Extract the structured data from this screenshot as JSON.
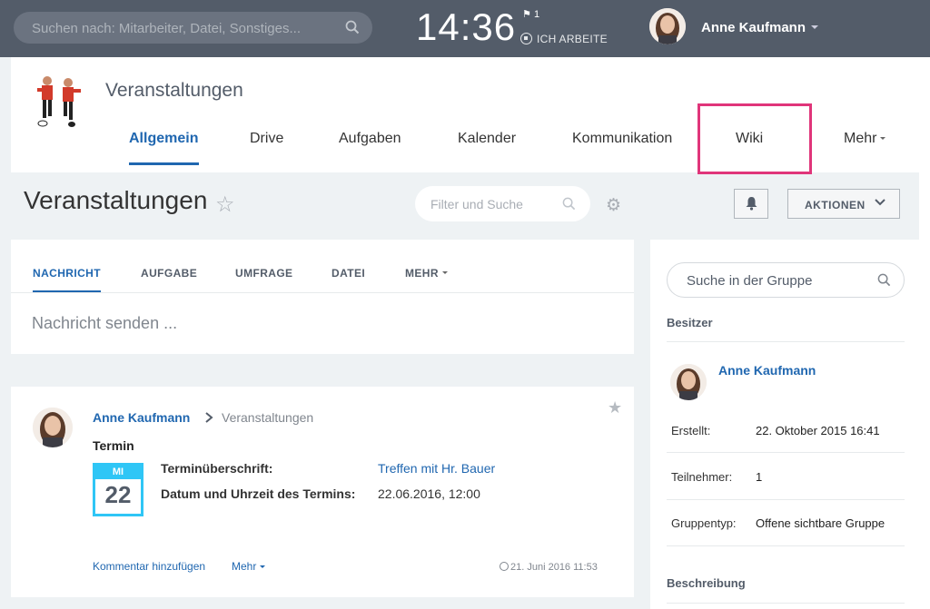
{
  "topbar": {
    "search_placeholder": "Suchen nach: Mitarbeiter, Datei, Sonstiges...",
    "clock": "14:36",
    "flag_count": "1",
    "work_status": "ICH ARBEITE",
    "user_name": "Anne Kaufmann"
  },
  "group": {
    "title": "Veranstaltungen",
    "tabs": [
      {
        "label": "Allgemein"
      },
      {
        "label": "Drive"
      },
      {
        "label": "Aufgaben"
      },
      {
        "label": "Kalender"
      },
      {
        "label": "Kommunikation"
      },
      {
        "label": "Wiki"
      },
      {
        "label": "Mehr"
      }
    ],
    "highlight_color": "#e0357a"
  },
  "page": {
    "title": "Veranstaltungen",
    "filter_placeholder": "Filter und Suche",
    "actions_label": "AKTIONEN"
  },
  "composer": {
    "tabs": [
      {
        "label": "NACHRICHT"
      },
      {
        "label": "AUFGABE"
      },
      {
        "label": "UMFRAGE"
      },
      {
        "label": "DATEI"
      },
      {
        "label": "MEHR"
      }
    ],
    "placeholder": "Nachricht senden ..."
  },
  "post": {
    "author": "Anne Kaufmann",
    "group": "Veranstaltungen",
    "type": "Termin",
    "cal_weekday": "MI",
    "cal_day": "22",
    "fields": [
      {
        "label": "Terminüberschrift:",
        "value": "Treffen mit Hr. Bauer"
      },
      {
        "label": "Datum und Uhrzeit des Termins:",
        "value": "22.06.2016, 12:00"
      }
    ],
    "comment_label": "Kommentar hinzufügen",
    "more_label": "Mehr",
    "date": "21. Juni 2016 11:53"
  },
  "sidebar": {
    "search_placeholder": "Suche in der Gruppe",
    "owner_heading": "Besitzer",
    "owner_name": "Anne Kaufmann",
    "details": [
      {
        "key": "Erstellt:",
        "value": "22. Oktober 2015 16:41"
      },
      {
        "key": "Teilnehmer:",
        "value": "1"
      },
      {
        "key": "Gruppentyp:",
        "value": "Offene sichtbare Gruppe"
      }
    ],
    "description_heading": "Beschreibung"
  },
  "colors": {
    "accent": "#2067b0",
    "topbar": "#535c69",
    "calendar": "#2fc6f6"
  }
}
